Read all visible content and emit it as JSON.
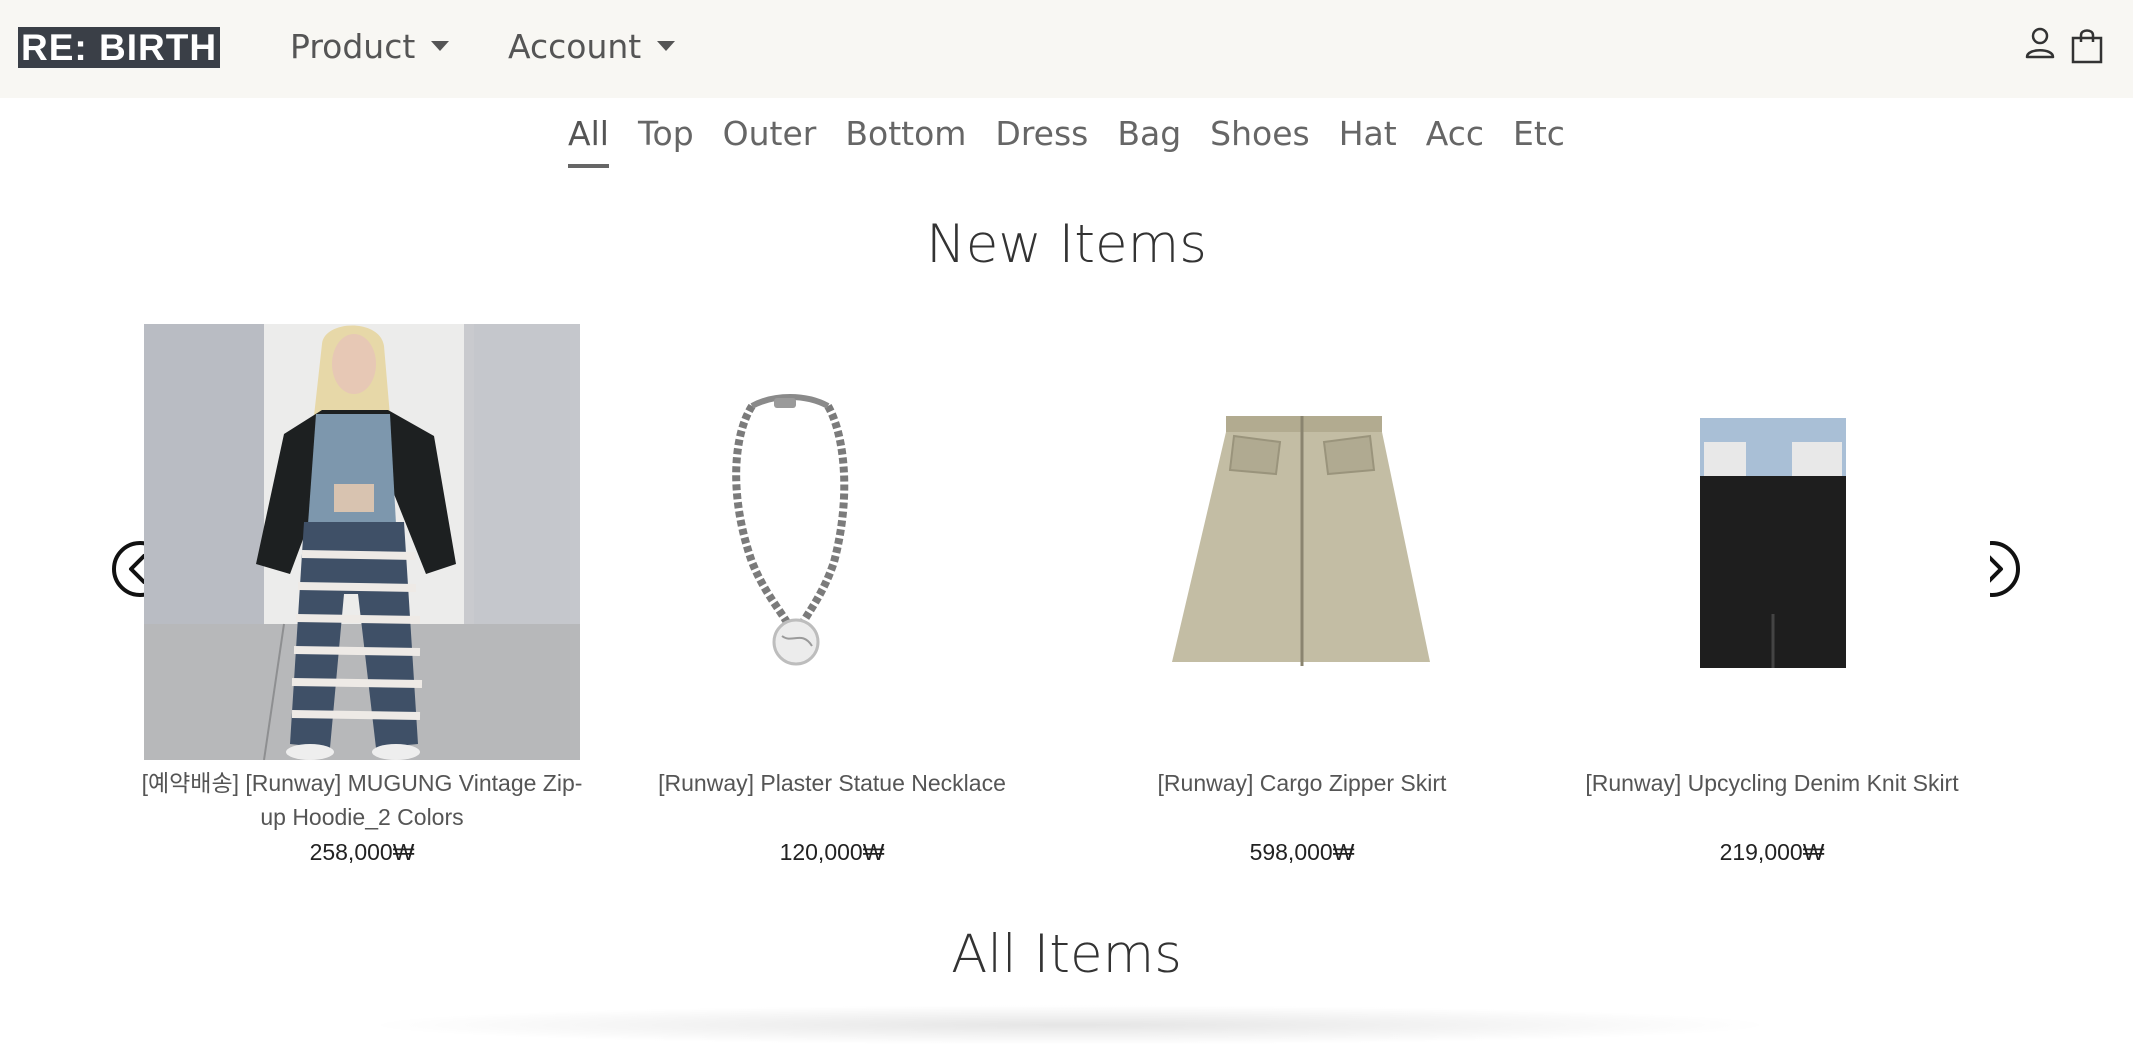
{
  "header": {
    "logo": "RE: BIRTH",
    "nav": [
      {
        "label": "Product"
      },
      {
        "label": "Account"
      }
    ],
    "icons": [
      "user-icon",
      "shopping-bag-icon"
    ]
  },
  "categories": [
    "All",
    "Top",
    "Outer",
    "Bottom",
    "Dress",
    "Bag",
    "Shoes",
    "Hat",
    "Acc",
    "Etc"
  ],
  "active_category": "All",
  "new_items": {
    "title": "New Items",
    "products": [
      {
        "name": "[예약배송] [Runway] MUGUNG Vintage Zip-up Hoodie_2 Colors",
        "price": "258,000₩"
      },
      {
        "name": "[Runway] Plaster Statue Necklace",
        "price": "120,000₩"
      },
      {
        "name": "[Runway] Cargo Zipper Skirt",
        "price": "598,000₩"
      },
      {
        "name": "[Runway] Upcycling Denim Knit Skirt",
        "price": "219,000₩"
      }
    ],
    "prev_icon": "chevron-left-circle-icon",
    "next_icon": "chevron-right-circle-icon"
  },
  "all_items": {
    "title": "All Items"
  }
}
